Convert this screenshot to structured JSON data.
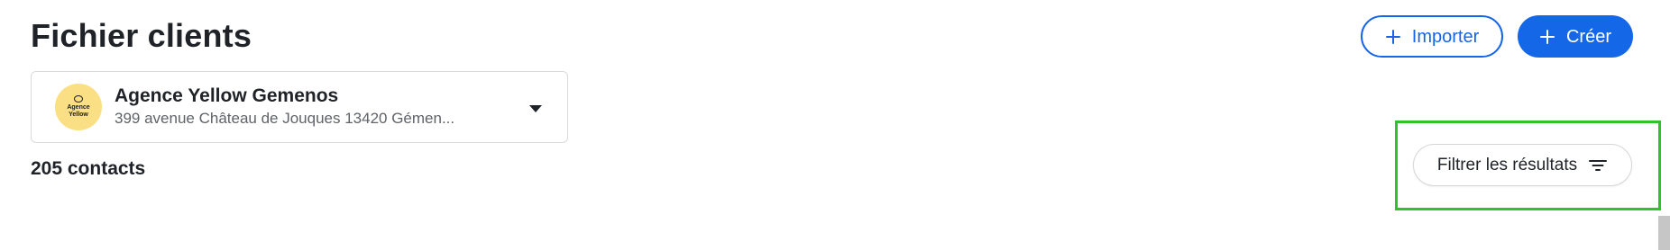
{
  "header": {
    "title": "Fichier clients",
    "import_label": "Importer",
    "create_label": "Créer"
  },
  "agency": {
    "logo_line1": "Agence",
    "logo_line2": "Yellow",
    "name": "Agence Yellow Gemenos",
    "address": "399 avenue Château de Jouques 13420 Gémen..."
  },
  "contacts": {
    "count_label": "205 contacts"
  },
  "filter": {
    "label": "Filtrer les résultats"
  },
  "icons": {
    "plus": "plus-icon",
    "caret": "caret-down-icon",
    "filter": "filter-icon"
  },
  "colors": {
    "accent": "#1468e8",
    "highlight": "#2fc32a",
    "avatar_bg": "#fbdf84"
  }
}
